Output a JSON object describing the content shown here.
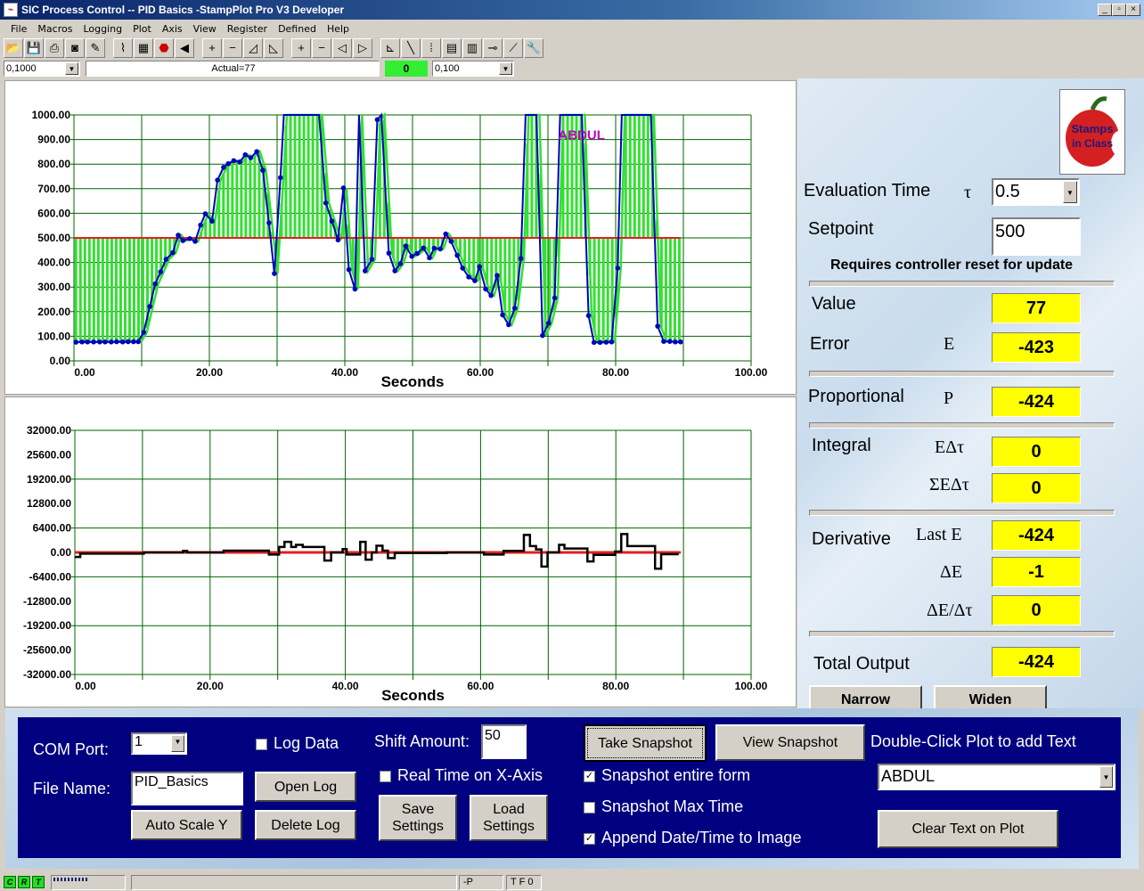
{
  "window": {
    "title": "SIC Process Control -- PID Basics -StampPlot Pro V3 Developer",
    "controls": [
      "_",
      "▫",
      "×"
    ]
  },
  "menu": [
    "File",
    "Macros",
    "Logging",
    "Plot",
    "Axis",
    "View",
    "Register",
    "Defined",
    "Help"
  ],
  "toolbar": {
    "icons": [
      "open-folder",
      "save",
      "print",
      "camera",
      "magic-wand",
      "sep",
      "plot-connect",
      "plot-grid",
      "stop",
      "back-arrow",
      "sep",
      "zoom-in-y",
      "zoom-out-y",
      "shift-up",
      "shift-down",
      "sep",
      "zoom-in-x",
      "zoom-out-x",
      "shift-left",
      "shift-right",
      "sep",
      "axis",
      "pen",
      "data-points",
      "notepad",
      "clipboard",
      "probe",
      "chart-line",
      "wrench"
    ],
    "x_range_combo": "0,1000",
    "message": "Actual=77",
    "indicator": "0",
    "y_range_combo": "0,100",
    "indicator_color": "#33ee33"
  },
  "colors": {
    "setpoint": "#e02020",
    "actual": "#0000c0",
    "bars": "#33e033",
    "output": "#000000",
    "grid": "#006400",
    "value_box": "#ffff00",
    "panel": "#000080"
  },
  "plot_annotation": "ABDUL",
  "chart_data": [
    {
      "type": "line",
      "xlabel": "Seconds",
      "xlim": [
        0,
        100
      ],
      "ylim": [
        0,
        1000
      ],
      "xticks": [
        "0.00",
        "20.00",
        "40.00",
        "60.00",
        "80.00",
        "100.00"
      ],
      "yticks": [
        "0.00",
        "100.00",
        "200.00",
        "300.00",
        "400.00",
        "500.00",
        "600.00",
        "700.00",
        "800.00",
        "900.00",
        "1000.00"
      ],
      "grid": true,
      "setpoint": 500,
      "series": [
        {
          "points": [
            [
              0.3,
              76
            ],
            [
              1.2,
              77
            ],
            [
              2.0,
              77
            ],
            [
              2.9,
              77
            ],
            [
              3.8,
              77
            ],
            [
              4.6,
              77
            ],
            [
              5.5,
              77
            ],
            [
              6.3,
              78
            ],
            [
              7.2,
              77
            ],
            [
              8.0,
              78
            ],
            [
              8.8,
              78
            ],
            [
              9.5,
              78
            ],
            [
              10.3,
              116
            ],
            [
              11.2,
              221
            ],
            [
              12.0,
              313
            ],
            [
              12.8,
              362
            ],
            [
              13.6,
              413
            ],
            [
              14.6,
              440
            ],
            [
              15.4,
              511
            ],
            [
              16.1,
              489
            ],
            [
              17.1,
              497
            ],
            [
              17.9,
              486
            ],
            [
              18.7,
              552
            ],
            [
              19.4,
              598
            ],
            [
              20.4,
              568
            ],
            [
              21.2,
              735
            ],
            [
              22.1,
              787
            ],
            [
              22.8,
              802
            ],
            [
              23.6,
              814
            ],
            [
              24.5,
              809
            ],
            [
              25.3,
              838
            ],
            [
              26.1,
              826
            ],
            [
              27.0,
              851
            ],
            [
              27.9,
              775
            ],
            [
              28.8,
              561
            ],
            [
              29.6,
              355
            ],
            [
              30.5,
              745
            ],
            [
              31.0,
              1000
            ],
            [
              36.2,
              1000
            ],
            [
              37.2,
              642
            ],
            [
              38.1,
              568
            ],
            [
              39.0,
              492
            ],
            [
              39.8,
              703
            ],
            [
              40.6,
              371
            ],
            [
              41.5,
              292
            ],
            [
              42.1,
              1000
            ],
            [
              43.0,
              366
            ],
            [
              44.0,
              413
            ],
            [
              44.8,
              981
            ],
            [
              45.4,
              1000
            ],
            [
              46.5,
              438
            ],
            [
              47.4,
              366
            ],
            [
              48.2,
              395
            ],
            [
              49.0,
              467
            ],
            [
              49.9,
              425
            ],
            [
              50.7,
              437
            ],
            [
              51.6,
              459
            ],
            [
              52.5,
              419
            ],
            [
              53.2,
              458
            ],
            [
              54.1,
              455
            ],
            [
              54.9,
              516
            ],
            [
              55.7,
              486
            ],
            [
              56.6,
              429
            ],
            [
              57.4,
              377
            ],
            [
              58.3,
              341
            ],
            [
              59.2,
              326
            ],
            [
              59.9,
              383
            ],
            [
              60.8,
              292
            ],
            [
              61.6,
              266
            ],
            [
              62.5,
              347
            ],
            [
              63.3,
              187
            ],
            [
              64.2,
              147
            ],
            [
              65.1,
              214
            ],
            [
              66.0,
              416
            ],
            [
              66.7,
              1000
            ],
            [
              68.3,
              1000
            ],
            [
              69.2,
              103
            ],
            [
              70.1,
              153
            ],
            [
              71.0,
              256
            ],
            [
              71.8,
              1000
            ],
            [
              75.0,
              1000
            ],
            [
              76.0,
              184
            ],
            [
              76.8,
              75
            ],
            [
              77.7,
              75
            ],
            [
              78.6,
              76
            ],
            [
              79.4,
              77
            ],
            [
              80.3,
              377
            ],
            [
              80.9,
              1000
            ],
            [
              85.2,
              1000
            ],
            [
              86.2,
              141
            ],
            [
              87.1,
              79
            ],
            [
              88.0,
              79
            ],
            [
              88.8,
              77
            ],
            [
              89.6,
              77
            ]
          ]
        }
      ]
    },
    {
      "type": "line",
      "xlabel": "Seconds",
      "xlim": [
        0,
        100
      ],
      "ylim": [
        -32000,
        32000
      ],
      "xticks": [
        "0.00",
        "20.00",
        "40.00",
        "60.00",
        "80.00",
        "100.00"
      ],
      "yticks": [
        "-32000.00",
        "-25600.00",
        "-19200.00",
        "-12800.00",
        "-6400.00",
        "0.00",
        "6400.00",
        "12800.00",
        "19200.00",
        "25600.00",
        "32000.00"
      ],
      "grid": true,
      "reference": 0,
      "series": [
        {
          "step": true,
          "points": [
            [
              0,
              -1185
            ],
            [
              0.8,
              -316
            ],
            [
              10.2,
              0
            ],
            [
              16,
              400
            ],
            [
              16.6,
              0
            ],
            [
              22,
              470
            ],
            [
              28.7,
              -550
            ],
            [
              30.2,
              1420
            ],
            [
              31.0,
              2770
            ],
            [
              32.0,
              1420
            ],
            [
              32.7,
              1975
            ],
            [
              33.7,
              1420
            ],
            [
              36.9,
              -2130
            ],
            [
              37.9,
              0
            ],
            [
              39.6,
              870
            ],
            [
              40.2,
              -550
            ],
            [
              42.2,
              2770
            ],
            [
              43.0,
              -1900
            ],
            [
              43.9,
              0
            ],
            [
              44.6,
              1740
            ],
            [
              45.5,
              470
            ],
            [
              46.3,
              -1500
            ],
            [
              47.3,
              -150
            ],
            [
              55,
              0
            ],
            [
              60.5,
              -550
            ],
            [
              63.4,
              400
            ],
            [
              66.4,
              4580
            ],
            [
              67.3,
              1660
            ],
            [
              68.2,
              790
            ],
            [
              69.0,
              -3710
            ],
            [
              69.9,
              0
            ],
            [
              71.6,
              1975
            ],
            [
              72.4,
              1030
            ],
            [
              75.8,
              -2370
            ],
            [
              76.7,
              -630
            ],
            [
              79.9,
              240
            ],
            [
              80.8,
              4820
            ],
            [
              81.7,
              1660
            ],
            [
              85.8,
              -4270
            ],
            [
              86.7,
              -470
            ],
            [
              89.3,
              -470
            ]
          ]
        }
      ]
    }
  ],
  "right": {
    "logo_text": "Stamps in Class",
    "eval_time": {
      "label": "Evaluation Time",
      "symbol": "τ",
      "value": "0.5"
    },
    "setpoint": {
      "label": "Setpoint",
      "value": "500"
    },
    "note": "Requires controller reset for update",
    "value": {
      "label": "Value",
      "value": "77"
    },
    "error": {
      "label": "Error",
      "symbol": "E",
      "value": "-423"
    },
    "proportional": {
      "label": "Proportional",
      "symbol": "P",
      "value": "-424"
    },
    "integral": {
      "label": "Integral",
      "sym1": "EΔτ",
      "val1": "0",
      "sym2": "ΣEΔτ",
      "val2": "0"
    },
    "derivative": {
      "label": "Derivative",
      "sym1": "Last E",
      "val1": "-424",
      "sym2": "ΔE",
      "val2": "-1",
      "sym3": "ΔE/Δτ",
      "val3": "0"
    },
    "total": {
      "label": "Total Output",
      "value": "-424"
    },
    "narrow": "Narrow",
    "widen": "Widen"
  },
  "bottom": {
    "com_label": "COM Port:",
    "com_value": "1",
    "log_data": "Log Data",
    "log_checked": false,
    "shift_label": "Shift Amount:",
    "shift_value": "50",
    "file_label": "File Name:",
    "file_value": "PID_Basics",
    "open_log": "Open Log",
    "real_time": "Real Time on X-Axis",
    "real_time_checked": false,
    "auto_scale": "Auto Scale Y",
    "delete_log": "Delete Log",
    "save_settings": "Save Settings",
    "load_settings": "Load Settings",
    "take_snapshot": "Take Snapshot",
    "view_snapshot": "View Snapshot",
    "dbl_click": "Double-Click Plot to add Text",
    "text_value": "ABDUL",
    "snap_form": "Snapshot entire form",
    "snap_form_checked": true,
    "snap_max": "Snapshot Max Time",
    "snap_max_checked": false,
    "append": "Append Date/Time to Image",
    "append_checked": true,
    "clear_text": "Clear Text on Plot"
  },
  "status": {
    "leds": [
      "C",
      "R",
      "T"
    ],
    "p": "-P",
    "tf": "T F 0"
  }
}
